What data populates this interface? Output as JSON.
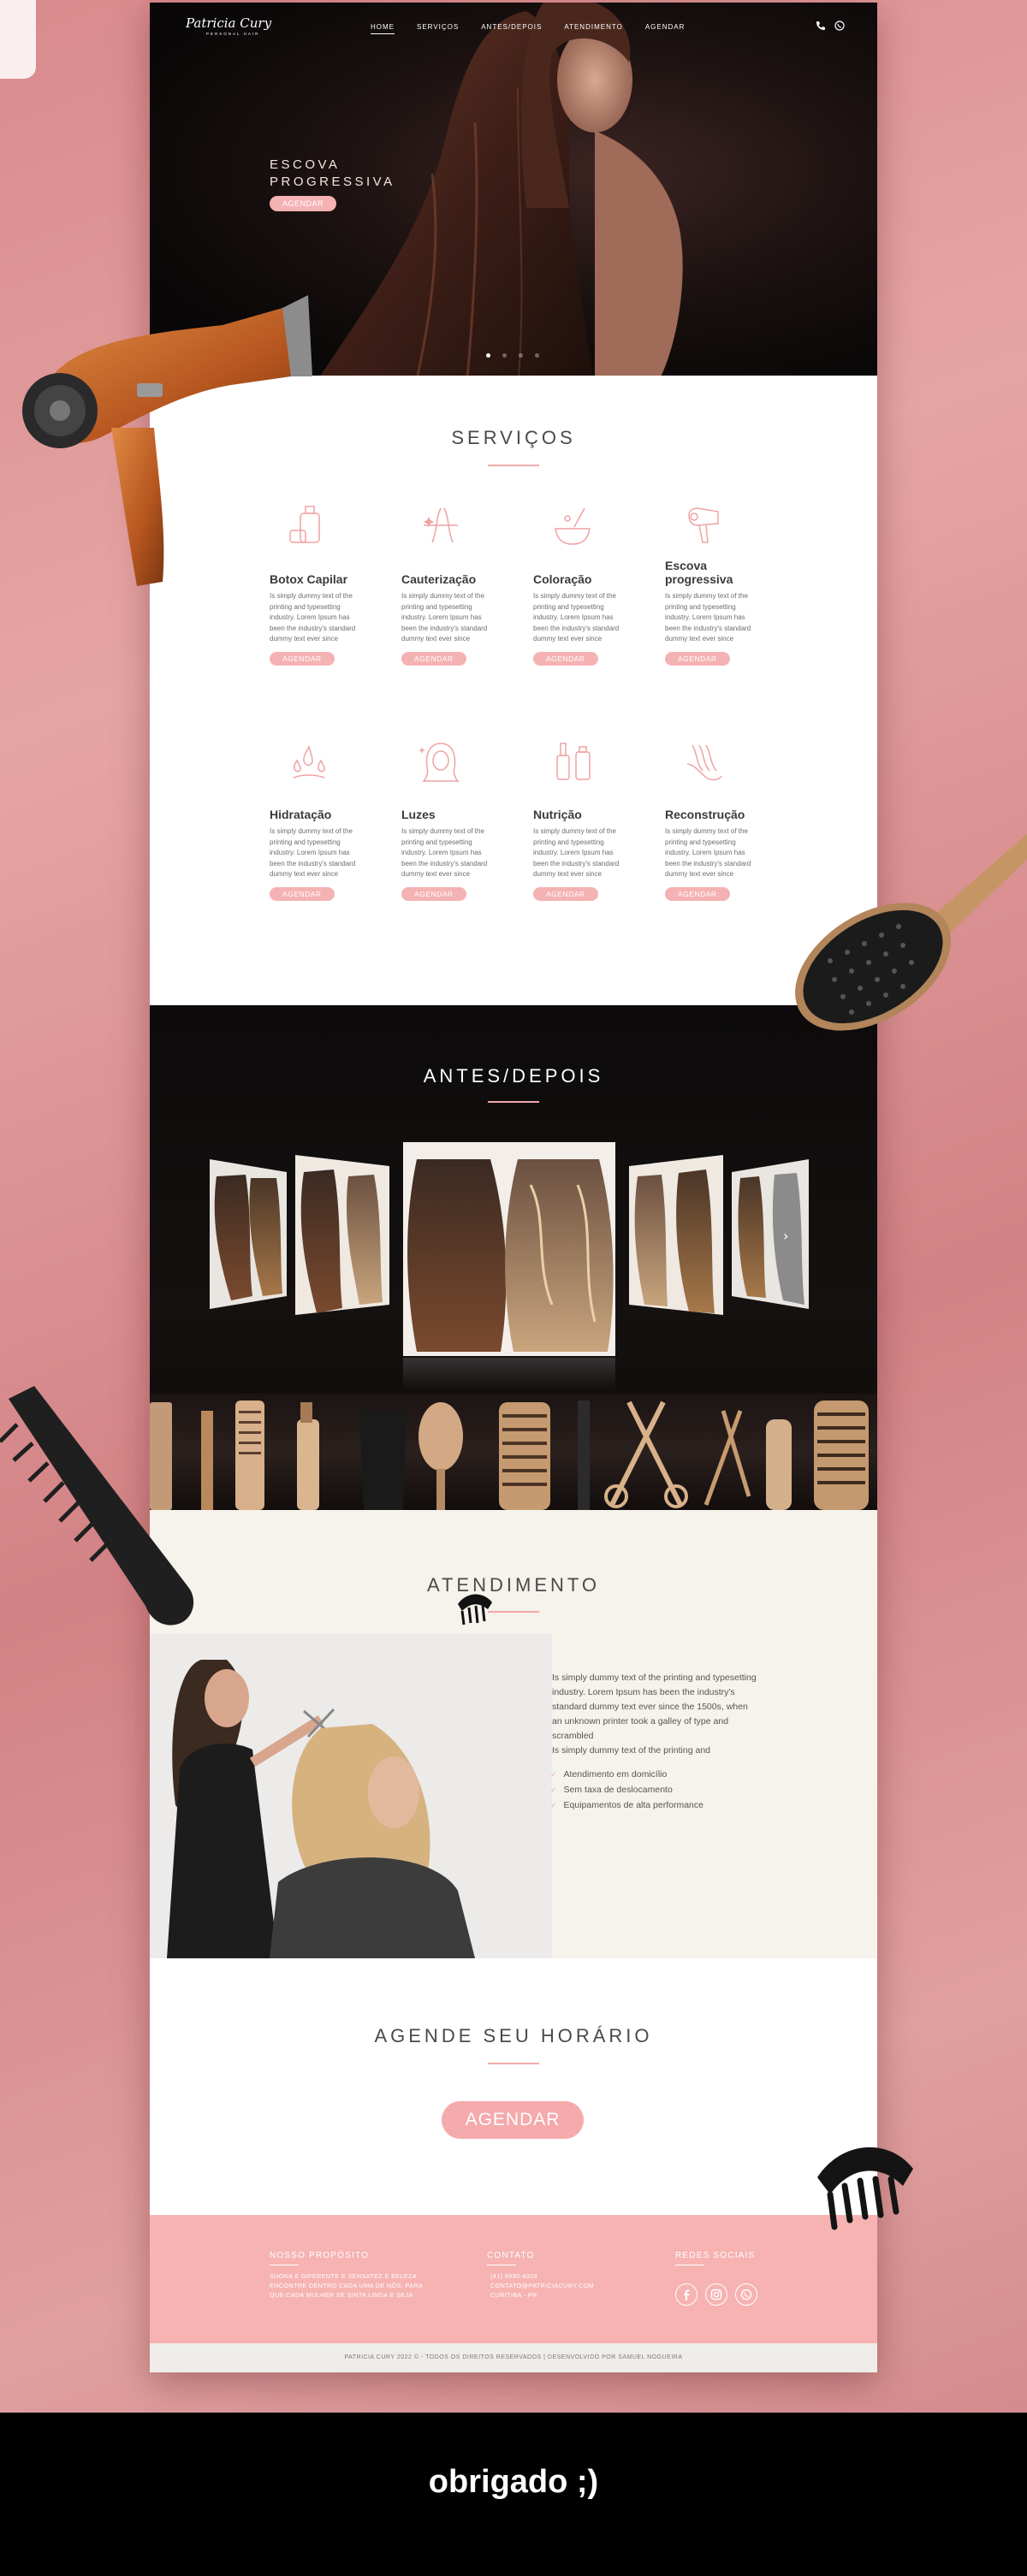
{
  "nav": {
    "logo_name": "Patricia Cury",
    "logo_sub": "PERSONAL HAIR",
    "items": [
      "HOME",
      "SERVIÇOS",
      "ANTES/DEPOIS",
      "ATENDIMENTO",
      "AGENDAR"
    ]
  },
  "hero": {
    "title_line1": "ESCOVA",
    "title_line2": "PROGRESSIVA",
    "button": "AGENDAR"
  },
  "services": {
    "title": "SERVIÇOS",
    "desc": "Is simply dummy text of the printing and typesetting industry. Lorem Ipsum has been the industry's standard dummy text ever since",
    "button": "AGENDAR",
    "items": [
      {
        "name": "Botox Capilar",
        "icon": "bottle-icon"
      },
      {
        "name": "Cauterização",
        "icon": "sparkle-hair-icon"
      },
      {
        "name": "Coloração",
        "icon": "color-bowl-icon"
      },
      {
        "name": "Escova progressiva",
        "icon": "hair-dryer-icon"
      },
      {
        "name": "Hidratação",
        "icon": "droplets-icon"
      },
      {
        "name": "Luzes",
        "icon": "woman-highlights-icon"
      },
      {
        "name": "Nutrição",
        "icon": "serum-icon"
      },
      {
        "name": "Reconstrução",
        "icon": "hair-hand-icon"
      }
    ]
  },
  "antes_depois": {
    "title": "ANTES/DEPOIS"
  },
  "atendimento": {
    "title": "ATENDIMENTO",
    "text": "Is simply dummy text of the printing and typesetting industry. Lorem Ipsum has been the industry's standard dummy text ever since the 1500s, when an unknown printer took a galley of type and scrambled",
    "text2": "Is simply dummy text of the printing and",
    "features": [
      "Atendimento em domicílio",
      "Sem taxa de deslocamento",
      "Equipamentos de alta performance"
    ]
  },
  "agende": {
    "title": "AGENDE SEU HORÁRIO",
    "button": "AGENDAR"
  },
  "footer": {
    "col1_title": "NOSSO PROPÓSITO",
    "col1_text": [
      "SUONA E DIFERENTE E SENSATEZ E BELEZA",
      "ENCONTRE DENTRO CADA UMA DE NÓS, PARA",
      "QUE CADA MULHER SE SINTA LINDA E SEJA"
    ],
    "col2_title": "CONTATO",
    "col2_text": [
      "(41) 9990-4003",
      "CONTATO@PATRICIACURY.COM",
      "CURITIBA - PR"
    ],
    "col3_title": "REDES SOCIAIS",
    "copyright": "PATRICIA CURY 2022 © - TODOS OS DIREITOS RESERVADOS | DESENVOLVIDO POR SAMUEL NOGUEIRA"
  },
  "thanks": "obrigado ;)",
  "colors": {
    "accent": "#f5b2b3",
    "dark": "#0c0a0a",
    "cream": "#f6f2ec",
    "background": "#d98a8c"
  }
}
